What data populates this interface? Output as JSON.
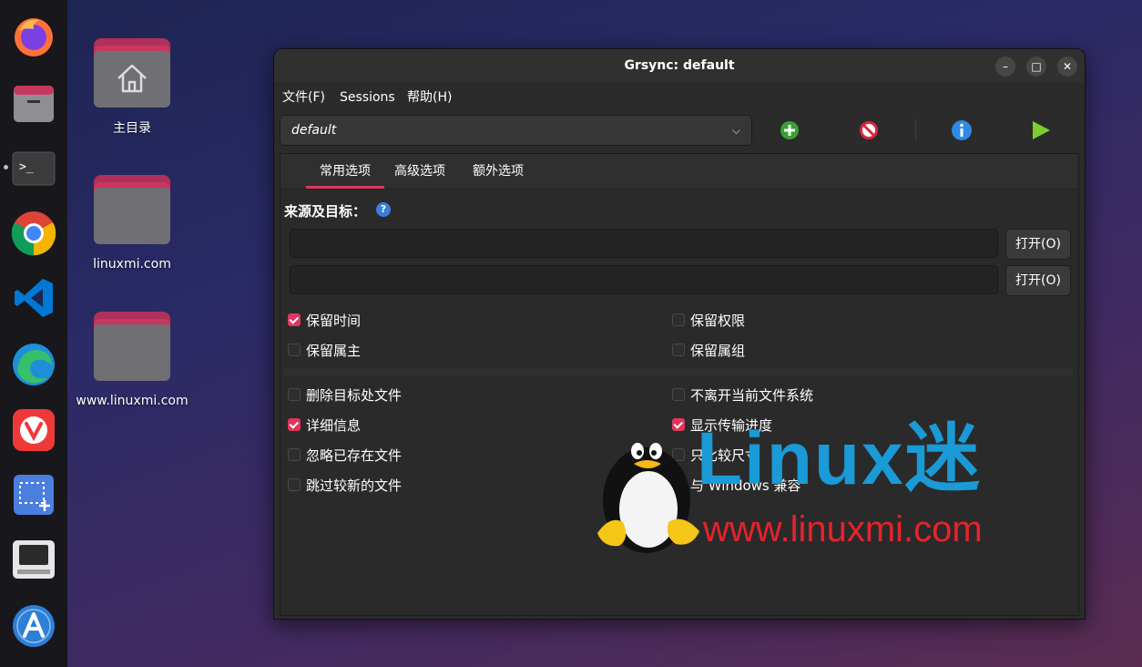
{
  "dock": {
    "items": [
      {
        "name": "firefox-icon"
      },
      {
        "name": "files-icon"
      },
      {
        "name": "terminal-icon"
      },
      {
        "name": "chrome-icon"
      },
      {
        "name": "vscode-icon"
      },
      {
        "name": "edge-icon"
      },
      {
        "name": "vivaldi-icon"
      },
      {
        "name": "screenshot-icon"
      },
      {
        "name": "computer-icon"
      },
      {
        "name": "appcenter-icon"
      }
    ]
  },
  "desktop": {
    "icons": [
      {
        "label": "主目录",
        "icon": "home-folder-icon"
      },
      {
        "label": "linuxmi.com",
        "icon": "folder-icon"
      },
      {
        "label": "www.linuxmi.com",
        "icon": "folder-icon"
      }
    ]
  },
  "window": {
    "title": "Grsync: default",
    "controls": {
      "minimize": "–",
      "maximize": "□",
      "close": "✕"
    },
    "menu": [
      "文件(F)",
      "Sessions",
      "帮助(H)"
    ],
    "session": {
      "value": "default"
    },
    "tabs": [
      "常用选项",
      "高级选项",
      "额外选项"
    ],
    "active_tab": "常用选项",
    "section_label": "来源及目标：",
    "source": {
      "value": "",
      "button": "打开(O)"
    },
    "destination": {
      "value": "",
      "button": "打开(O)"
    },
    "options_group1": {
      "left": [
        {
          "label": "保留时间",
          "checked": true
        },
        {
          "label": "保留属主",
          "checked": false
        }
      ],
      "right": [
        {
          "label": "保留权限",
          "checked": false
        },
        {
          "label": "保留属组",
          "checked": false
        }
      ]
    },
    "options_group2": {
      "left": [
        {
          "label": "删除目标处文件",
          "checked": false
        },
        {
          "label": "详细信息",
          "checked": true
        },
        {
          "label": "忽略已存在文件",
          "checked": false
        },
        {
          "label": "跳过较新的文件",
          "checked": false
        }
      ],
      "right": [
        {
          "label": "不离开当前文件系统",
          "checked": false
        },
        {
          "label": "显示传输进度",
          "checked": true
        },
        {
          "label": "只比较尺寸",
          "checked": false
        },
        {
          "label": "与 Windows 兼容",
          "checked": false
        }
      ]
    }
  },
  "watermark": {
    "brand": "Linux迷",
    "url": "www.linuxmi.com"
  },
  "colors": {
    "accent": "#e0365e",
    "watermark_blue": "#1a9ad6",
    "watermark_red": "#e5232b"
  }
}
